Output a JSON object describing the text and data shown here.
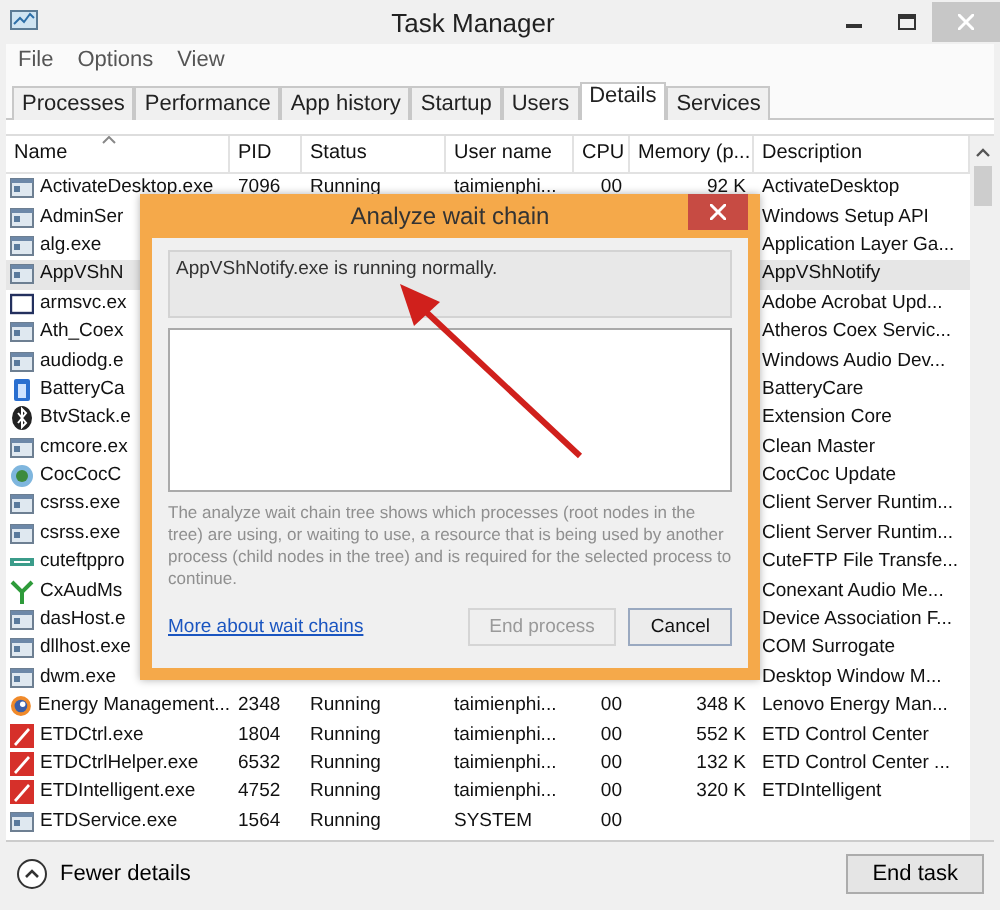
{
  "window": {
    "title": "Task Manager"
  },
  "menu": [
    "File",
    "Options",
    "View"
  ],
  "tabs": [
    {
      "label": "Processes",
      "selected": false
    },
    {
      "label": "Performance",
      "selected": false
    },
    {
      "label": "App history",
      "selected": false
    },
    {
      "label": "Startup",
      "selected": false
    },
    {
      "label": "Users",
      "selected": false
    },
    {
      "label": "Details",
      "selected": true
    },
    {
      "label": "Services",
      "selected": false
    }
  ],
  "table": {
    "columns": [
      "Name",
      "PID",
      "Status",
      "User name",
      "CPU",
      "Memory (p...",
      "Description"
    ],
    "rows": [
      {
        "kind": "generic",
        "name": "ActivateDesktop.exe",
        "pid": "7096",
        "status": "Running",
        "user": "taimienphi...",
        "cpu": "00",
        "memory": "92 K",
        "description": "ActivateDesktop",
        "selected": false
      },
      {
        "kind": "generic",
        "name": "AdminSer",
        "description": "Windows Setup API",
        "selected": false
      },
      {
        "kind": "generic",
        "name": "alg.exe",
        "description": "Application Layer Ga...",
        "selected": false
      },
      {
        "kind": "generic",
        "name": "AppVShN",
        "description": "AppVShNotify",
        "selected": true
      },
      {
        "kind": "outline",
        "name": "armsvc.ex",
        "description": "Adobe Acrobat Upd...",
        "selected": false
      },
      {
        "kind": "generic",
        "name": "Ath_Coex",
        "description": "Atheros Coex Servic...",
        "selected": false
      },
      {
        "kind": "generic",
        "name": "audiodg.e",
        "description": "Windows Audio Dev...",
        "selected": false
      },
      {
        "kind": "battery",
        "name": "BatteryCa",
        "description": "BatteryCare",
        "selected": false
      },
      {
        "kind": "bluetooth",
        "name": "BtvStack.e",
        "description": "Extension Core",
        "selected": false
      },
      {
        "kind": "generic",
        "name": "cmcore.ex",
        "description": "Clean Master",
        "selected": false
      },
      {
        "kind": "globe",
        "name": "CocCocC",
        "description": "CocCoc Update",
        "selected": false
      },
      {
        "kind": "generic",
        "name": "csrss.exe",
        "description": "Client Server Runtim...",
        "selected": false
      },
      {
        "kind": "generic",
        "name": "csrss.exe",
        "description": "Client Server Runtim...",
        "selected": false
      },
      {
        "kind": "ftp",
        "name": "cuteftppro",
        "description": "CuteFTP File Transfe...",
        "selected": false
      },
      {
        "kind": "fork",
        "name": "CxAudMs",
        "description": "Conexant Audio Me...",
        "selected": false
      },
      {
        "kind": "generic",
        "name": "dasHost.e",
        "description": "Device Association F...",
        "selected": false
      },
      {
        "kind": "generic",
        "name": "dllhost.exe",
        "description": "COM Surrogate",
        "selected": false
      },
      {
        "kind": "generic",
        "name": "dwm.exe",
        "description": "Desktop Window M...",
        "selected": false
      },
      {
        "kind": "swirl",
        "name": "Energy Management...",
        "pid": "2348",
        "status": "Running",
        "user": "taimienphi...",
        "cpu": "00",
        "memory": "348 K",
        "description": "Lenovo Energy Man...",
        "selected": false
      },
      {
        "kind": "pen",
        "name": "ETDCtrl.exe",
        "pid": "1804",
        "status": "Running",
        "user": "taimienphi...",
        "cpu": "00",
        "memory": "552 K",
        "description": "ETD Control Center",
        "selected": false
      },
      {
        "kind": "pen",
        "name": "ETDCtrlHelper.exe",
        "pid": "6532",
        "status": "Running",
        "user": "taimienphi...",
        "cpu": "00",
        "memory": "132 K",
        "description": "ETD Control Center ...",
        "selected": false
      },
      {
        "kind": "pen",
        "name": "ETDIntelligent.exe",
        "pid": "4752",
        "status": "Running",
        "user": "taimienphi...",
        "cpu": "00",
        "memory": "320 K",
        "description": "ETDIntelligent",
        "selected": false
      },
      {
        "kind": "generic",
        "name": "ETDService.exe",
        "pid": "1564",
        "status": "Running",
        "user": "SYSTEM",
        "cpu": "00",
        "selected": false
      }
    ]
  },
  "dialog": {
    "title": "Analyze wait chain",
    "status_text": "AppVShNotify.exe is running normally.",
    "explanation": "The analyze wait chain tree shows which processes (root nodes in the tree) are using, or waiting to use, a resource that is being used by another process (child nodes in the tree) and is required for the selected process to continue.",
    "link": "More about wait chains",
    "buttons": [
      {
        "label": "End process",
        "disabled": true
      },
      {
        "label": "Cancel",
        "disabled": false
      }
    ]
  },
  "status_bar": {
    "toggle": "Fewer details",
    "button": "End task"
  }
}
